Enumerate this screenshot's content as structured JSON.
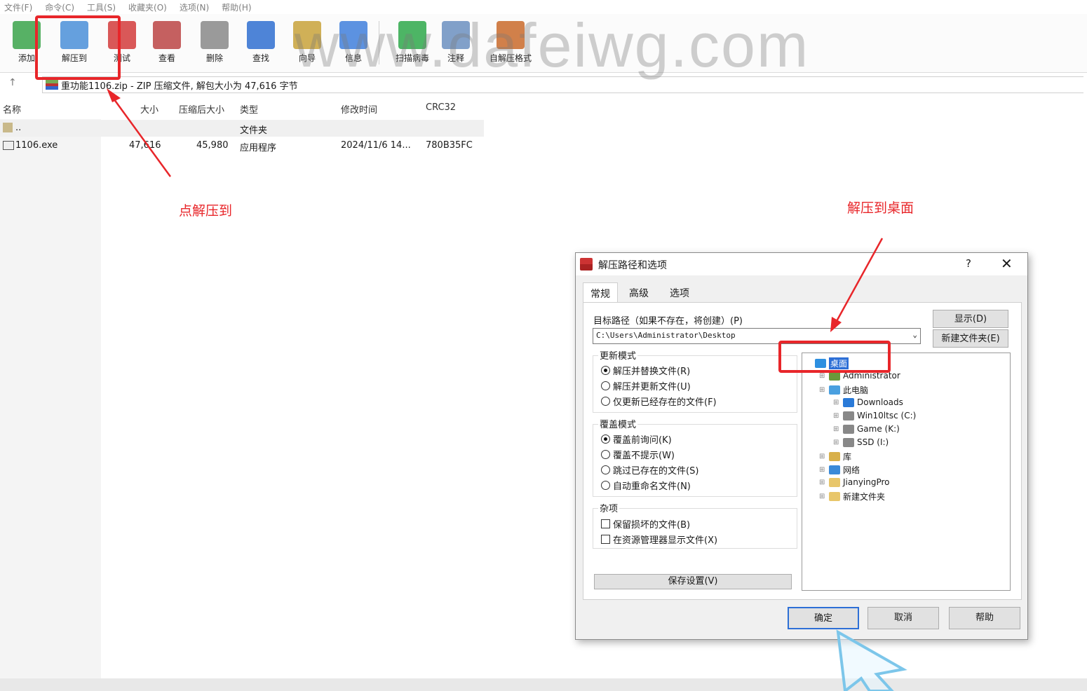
{
  "menu": [
    "文件(F)",
    "命令(C)",
    "工具(S)",
    "收藏夹(O)",
    "选项(N)",
    "帮助(H)"
  ],
  "toolbar": {
    "buttons": [
      {
        "label": "添加",
        "icon": "add-icon",
        "color": "#3aa34a"
      },
      {
        "label": "解压到",
        "icon": "extract-folder-icon",
        "color": "#4a8fd8"
      },
      {
        "label": "测试",
        "icon": "test-icon",
        "color": "#d23b3b"
      },
      {
        "label": "查看",
        "icon": "view-book-icon",
        "color": "#b44"
      },
      {
        "label": "删除",
        "icon": "trash-icon",
        "color": "#888"
      },
      {
        "label": "查找",
        "icon": "magnifier-icon",
        "color": "#2f6fd0"
      },
      {
        "label": "向导",
        "icon": "wand-icon",
        "color": "#c8a23a"
      },
      {
        "label": "信息",
        "icon": "info-icon",
        "color": "#3f7fdc"
      },
      {
        "label": "扫描病毒",
        "icon": "virus-scan-icon",
        "color": "#2ea84a"
      },
      {
        "label": "注释",
        "icon": "comment-icon",
        "color": "#6b8fbf"
      },
      {
        "label": "自解压格式",
        "icon": "sfx-icon",
        "color": "#c96a2a"
      }
    ]
  },
  "address": {
    "text": "重功能1106.zip - ZIP 压缩文件, 解包大小为 47,616 字节",
    "up": "↑"
  },
  "columns": [
    "名称",
    "大小",
    "压缩后大小",
    "类型",
    "修改时间",
    "CRC32"
  ],
  "rows": [
    {
      "name": "..",
      "size": "",
      "packed": "",
      "type": "文件夹",
      "mtime": "",
      "crc": ""
    },
    {
      "name": "1106.exe",
      "size": "47,616",
      "packed": "45,980",
      "type": "应用程序",
      "mtime": "2024/11/6 14...",
      "crc": "780B35FC"
    }
  ],
  "watermark": "www.dafeiwg.com",
  "annotations": {
    "extract_hint": "点解压到",
    "desktop_hint": "解压到桌面",
    "accent": "#e8262a"
  },
  "dialog": {
    "title": "解压路径和选项",
    "help": "?",
    "close": "✕",
    "tabs": [
      "常规",
      "高级",
      "选项"
    ],
    "path_label": "目标路径（如果不存在，将创建）(P)",
    "path_value": "C:\\Users\\Administrator\\Desktop",
    "show_button": "显示(D)",
    "new_folder_button": "新建文件夹(E)",
    "update_mode": {
      "label": "更新模式",
      "options": [
        "解压并替换文件(R)",
        "解压并更新文件(U)",
        "仅更新已经存在的文件(F)"
      ],
      "selected": 0
    },
    "overwrite_mode": {
      "label": "覆盖模式",
      "options": [
        "覆盖前询问(K)",
        "覆盖不提示(W)",
        "跳过已存在的文件(S)",
        "自动重命名文件(N)"
      ],
      "selected": 0
    },
    "misc": {
      "label": "杂项",
      "options": [
        "保留损坏的文件(B)",
        "在资源管理器显示文件(X)"
      ]
    },
    "save_button": "保存设置(V)",
    "tree": [
      {
        "label": "桌面",
        "icon": "desktop-icon",
        "level": 0,
        "selected": true
      },
      {
        "label": "Administrator",
        "icon": "user-icon",
        "level": 1
      },
      {
        "label": "此电脑",
        "icon": "computer-icon",
        "level": 1
      },
      {
        "label": "Downloads",
        "icon": "download-icon",
        "level": 2
      },
      {
        "label": "Win10ltsc (C:)",
        "icon": "drive-icon",
        "level": 2
      },
      {
        "label": "Game (K:)",
        "icon": "drive-icon",
        "level": 2
      },
      {
        "label": "SSD (I:)",
        "icon": "drive-icon",
        "level": 2
      },
      {
        "label": "库",
        "icon": "library-icon",
        "level": 1
      },
      {
        "label": "网络",
        "icon": "network-icon",
        "level": 1
      },
      {
        "label": "JianyingPro",
        "icon": "folder-icon",
        "level": 1
      },
      {
        "label": "新建文件夹",
        "icon": "folder-icon",
        "level": 1
      }
    ],
    "ok": "确定",
    "cancel": "取消",
    "help_button": "帮助"
  }
}
